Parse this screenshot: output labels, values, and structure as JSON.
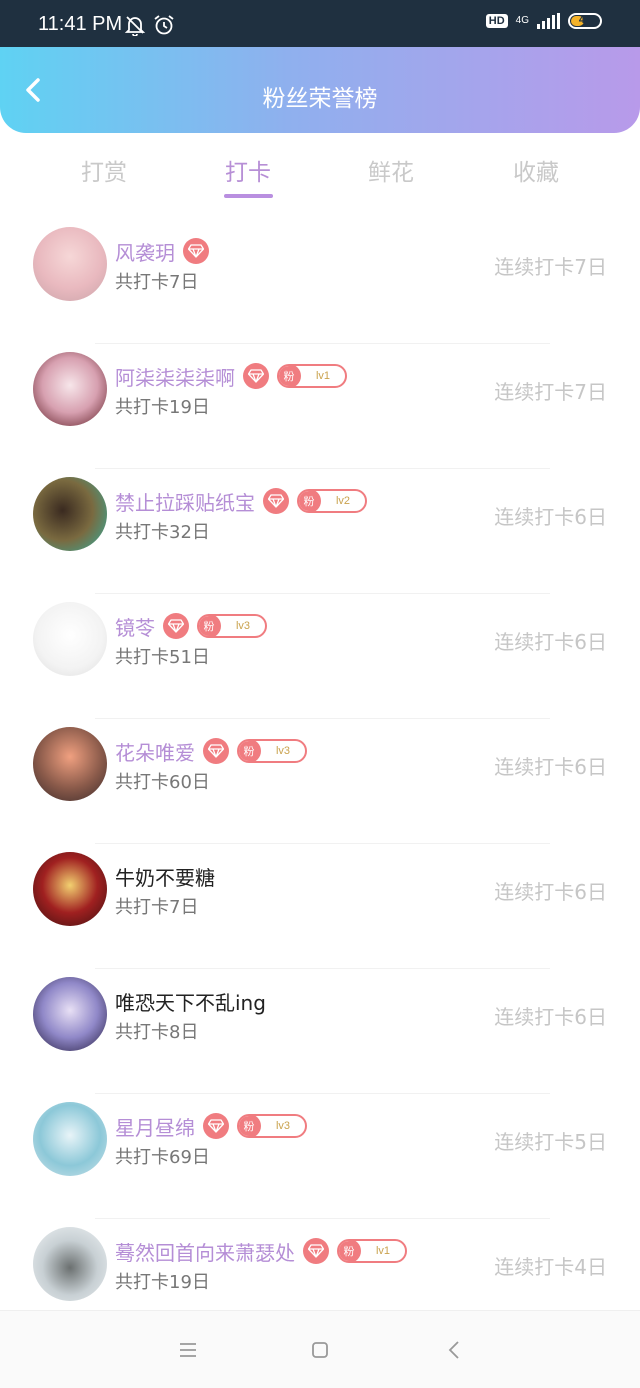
{
  "status_bar": {
    "time": "11:41 PM",
    "hd_label": "HD",
    "network": "4G",
    "battery": "47",
    "battery_level": 0.47,
    "icons": [
      "bell-off-icon",
      "alarm-icon",
      "signal-icon",
      "battery-icon"
    ]
  },
  "header": {
    "title": "粉丝荣誉榜",
    "back_icon": "chevron-left-icon"
  },
  "tabs": [
    {
      "label": "打赏",
      "active": false
    },
    {
      "label": "打卡",
      "active": true
    },
    {
      "label": "鲜花",
      "active": false
    },
    {
      "label": "收藏",
      "active": false
    }
  ],
  "colors": {
    "header_gradient_start": "#5fd2f3",
    "header_gradient_end": "#b89aea",
    "accent_purple": "#b58ed6",
    "badge_red": "#f07c80",
    "streak_gray": "#c6c6c6"
  },
  "fans": [
    {
      "name": "风袭玥",
      "has_gem": true,
      "fan_label": "",
      "level": "",
      "total": "共打卡7日",
      "streak": "连续打卡7日"
    },
    {
      "name": "阿柒柒柒柒啊",
      "has_gem": true,
      "fan_label": "粉",
      "level": "lv1",
      "total": "共打卡19日",
      "streak": "连续打卡7日"
    },
    {
      "name": "禁止拉踩贴纸宝",
      "has_gem": true,
      "fan_label": "粉",
      "level": "lv2",
      "total": "共打卡32日",
      "streak": "连续打卡6日"
    },
    {
      "name": "镜苓",
      "has_gem": true,
      "fan_label": "粉",
      "level": "lv3",
      "total": "共打卡51日",
      "streak": "连续打卡6日"
    },
    {
      "name": "花朵唯爱",
      "has_gem": true,
      "fan_label": "粉",
      "level": "lv3",
      "total": "共打卡60日",
      "streak": "连续打卡6日"
    },
    {
      "name": "牛奶不要糖",
      "has_gem": false,
      "fan_label": "",
      "level": "",
      "total": "共打卡7日",
      "streak": "连续打卡6日"
    },
    {
      "name": "唯恐天下不乱ing",
      "has_gem": false,
      "fan_label": "",
      "level": "",
      "total": "共打卡8日",
      "streak": "连续打卡6日"
    },
    {
      "name": "星月昼绵",
      "has_gem": true,
      "fan_label": "粉",
      "level": "lv3",
      "total": "共打卡69日",
      "streak": "连续打卡5日"
    },
    {
      "name": "蓦然回首向来萧瑟处",
      "has_gem": true,
      "fan_label": "粉",
      "level": "lv1",
      "total": "共打卡19日",
      "streak": "连续打卡4日"
    }
  ],
  "nav_bar": {
    "icons": [
      "menu-icon",
      "home-square-icon",
      "back-triangle-icon"
    ]
  }
}
